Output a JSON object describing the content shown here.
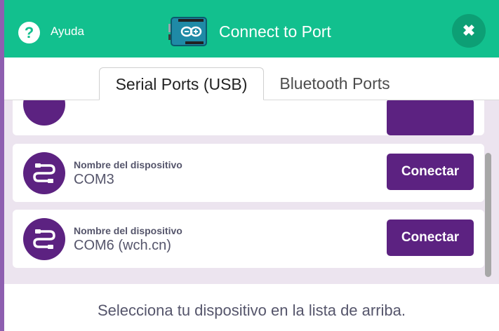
{
  "header": {
    "help_label": "Ayuda",
    "help_symbol": "?",
    "title": "Connect to Port",
    "close_symbol": "✖",
    "background_color": "#12c08e"
  },
  "tabs": [
    {
      "label": "Serial Ports (USB)",
      "active": true
    },
    {
      "label": "Bluetooth Ports",
      "active": false
    }
  ],
  "devices": [
    {
      "label": "",
      "value": "",
      "button": ""
    },
    {
      "label": "Nombre del dispositivo",
      "value": "COM3",
      "button": "Conectar"
    },
    {
      "label": "Nombre del dispositivo",
      "value": "COM6 (wch.cn)",
      "button": "Conectar"
    }
  ],
  "footer": {
    "text": "Selecciona tu dispositivo en la lista de arriba."
  },
  "colors": {
    "accent": "#5c2281",
    "list_background": "#ece4ef",
    "text": "#55556b"
  },
  "icons": {
    "help": "question-icon",
    "board": "arduino-board-icon",
    "close": "close-icon",
    "device": "usb-cable-icon"
  }
}
